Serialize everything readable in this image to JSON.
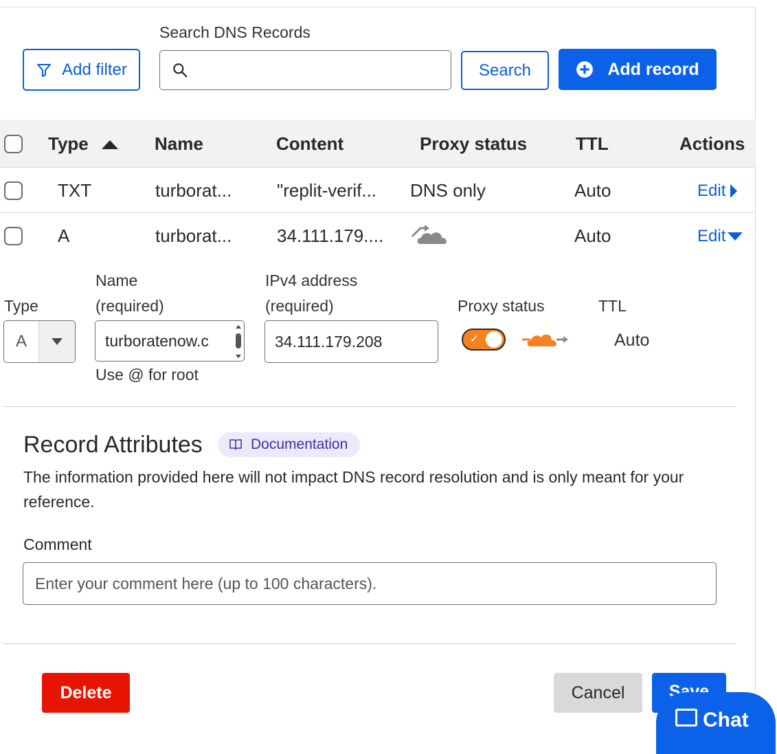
{
  "toolbar": {
    "add_filter_label": "Add filter",
    "search_label": "Search DNS Records",
    "search_value": "",
    "search_button": "Search",
    "add_record_label": "Add record"
  },
  "table": {
    "headers": {
      "type": "Type",
      "name": "Name",
      "content": "Content",
      "proxy_status": "Proxy status",
      "ttl": "TTL",
      "actions": "Actions"
    },
    "sort": {
      "column": "Type",
      "direction": "ascending"
    },
    "rows": [
      {
        "type": "TXT",
        "name": "turborat...",
        "content": "\"replit-verif...",
        "proxy": "DNS only",
        "ttl": "Auto",
        "action": "Edit",
        "expanded": false
      },
      {
        "type": "A",
        "name": "turborat...",
        "content": "34.111.179....",
        "proxy_icon": "cloud-dns-only-icon",
        "ttl": "Auto",
        "action": "Edit",
        "expanded": true
      }
    ]
  },
  "edit_form": {
    "type_label": "Type",
    "type_value": "A",
    "name_label_line1": "Name",
    "name_label_line2": "(required)",
    "name_value": "turboratenow.c",
    "name_help": "Use @ for root",
    "ipv4_label_line1": "IPv4 address",
    "ipv4_label_line2": "(required)",
    "ipv4_value": "34.111.179.208",
    "proxy_label": "Proxy status",
    "proxy_enabled": true,
    "ttl_label": "TTL",
    "ttl_value": "Auto"
  },
  "attributes": {
    "title": "Record Attributes",
    "doc_badge": "Documentation",
    "description": "The information provided here will not impact DNS record resolution and is only meant for your reference.",
    "comment_label": "Comment",
    "comment_placeholder": "Enter your comment here (up to 100 characters).",
    "comment_value": ""
  },
  "footer": {
    "delete_label": "Delete",
    "cancel_label": "Cancel",
    "save_label": "Save",
    "chat_label": "Chat"
  },
  "colors": {
    "primary": "#0b62e8",
    "link": "#0a5fd6",
    "danger": "#e81403",
    "proxy_orange": "#f6821f",
    "badge_bg": "#ece9fb"
  }
}
